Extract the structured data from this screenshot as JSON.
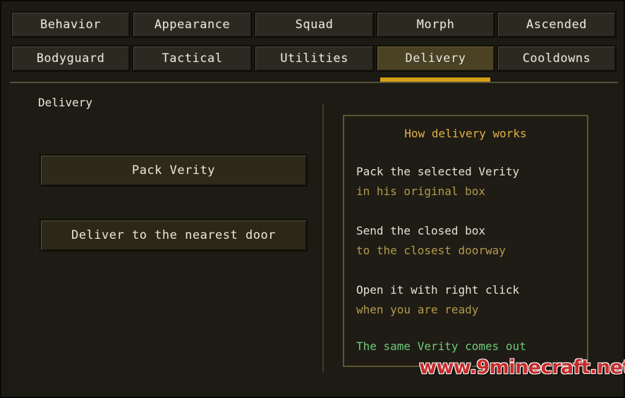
{
  "tabs_row1": [
    {
      "label": "Behavior"
    },
    {
      "label": "Appearance"
    },
    {
      "label": "Squad"
    },
    {
      "label": "Morph"
    },
    {
      "label": "Ascended"
    }
  ],
  "tabs_row2": [
    {
      "label": "Bodyguard"
    },
    {
      "label": "Tactical"
    },
    {
      "label": "Utilities"
    },
    {
      "label": "Delivery",
      "active": true
    },
    {
      "label": "Cooldowns"
    }
  ],
  "section": {
    "title": "Delivery"
  },
  "buttons": {
    "pack": "Pack Verity",
    "deliver": "Deliver to the nearest door"
  },
  "info": {
    "title": "How delivery works",
    "lines": [
      {
        "text": "Pack the selected Verity",
        "style": "main"
      },
      {
        "text": "in his original box",
        "style": "sub"
      },
      {
        "text": "Send the closed box",
        "style": "main"
      },
      {
        "text": "to the closest doorway",
        "style": "sub"
      },
      {
        "text": "Open it with right click",
        "style": "main"
      },
      {
        "text": "when you are ready",
        "style": "sub"
      },
      {
        "text": "The same Verity comes out",
        "style": "green"
      }
    ]
  },
  "watermark": "www.9minecraft.net",
  "colors": {
    "accent": "#d4a017",
    "info_title": "#e2b04a",
    "subtext": "#b49a4d",
    "highlight_green": "#6ec97a"
  }
}
